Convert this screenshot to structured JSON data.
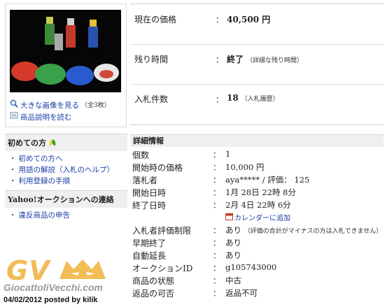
{
  "thumbnail": {
    "view_large_label": "大きな画像を見る",
    "count_note": "（全3枚）",
    "description_label": "商品説明を読む"
  },
  "summary": {
    "price_label": "現在の価格",
    "price_value": "40,500 円",
    "time_label": "残り時間",
    "time_value": "終了",
    "time_link": "詳細な残り時間",
    "bids_label": "入札件数",
    "bids_value": "18",
    "bids_link": "入札履歴"
  },
  "beginners": {
    "title": "初めての方",
    "items": [
      "初めての方へ",
      "用語の解説（入札のヘルプ）",
      "利用登録の手順"
    ]
  },
  "contact": {
    "title": "Yahoo!オークションへの連絡",
    "items": [
      "違反商品の申告"
    ]
  },
  "detail": {
    "title": "詳細情報",
    "rows": [
      {
        "label": "個数",
        "value": "1"
      },
      {
        "label": "開始時の価格",
        "value": "10,000 円"
      },
      {
        "label": "落札者",
        "value": "aya***** / 評価： 125"
      },
      {
        "label": "開始日時",
        "value": "1月 28日 22時 8分"
      },
      {
        "label": "終了日時",
        "value": "2月 4日 22時 6分"
      },
      {
        "label": "入札者評価制限",
        "value": "あり",
        "note": "（評価の合計がマイナスの方は入札できません）"
      },
      {
        "label": "早期終了",
        "value": "あり"
      },
      {
        "label": "自動延長",
        "value": "あり"
      },
      {
        "label": "オークションID",
        "value": "g105743000"
      },
      {
        "label": "商品の状態",
        "value": "中古"
      },
      {
        "label": "返品の可否",
        "value": "返品不可"
      }
    ],
    "calendar_link": "カレンダーに追加"
  },
  "watermark": {
    "logo": "GV",
    "site": "GiocattoliVecchi.com",
    "posted": "04/02/2012 posted by kilik"
  },
  "colors": {
    "link": "#1a3ea8",
    "header_bg": "#efefef",
    "watermark_orange": "#f0b03a"
  }
}
